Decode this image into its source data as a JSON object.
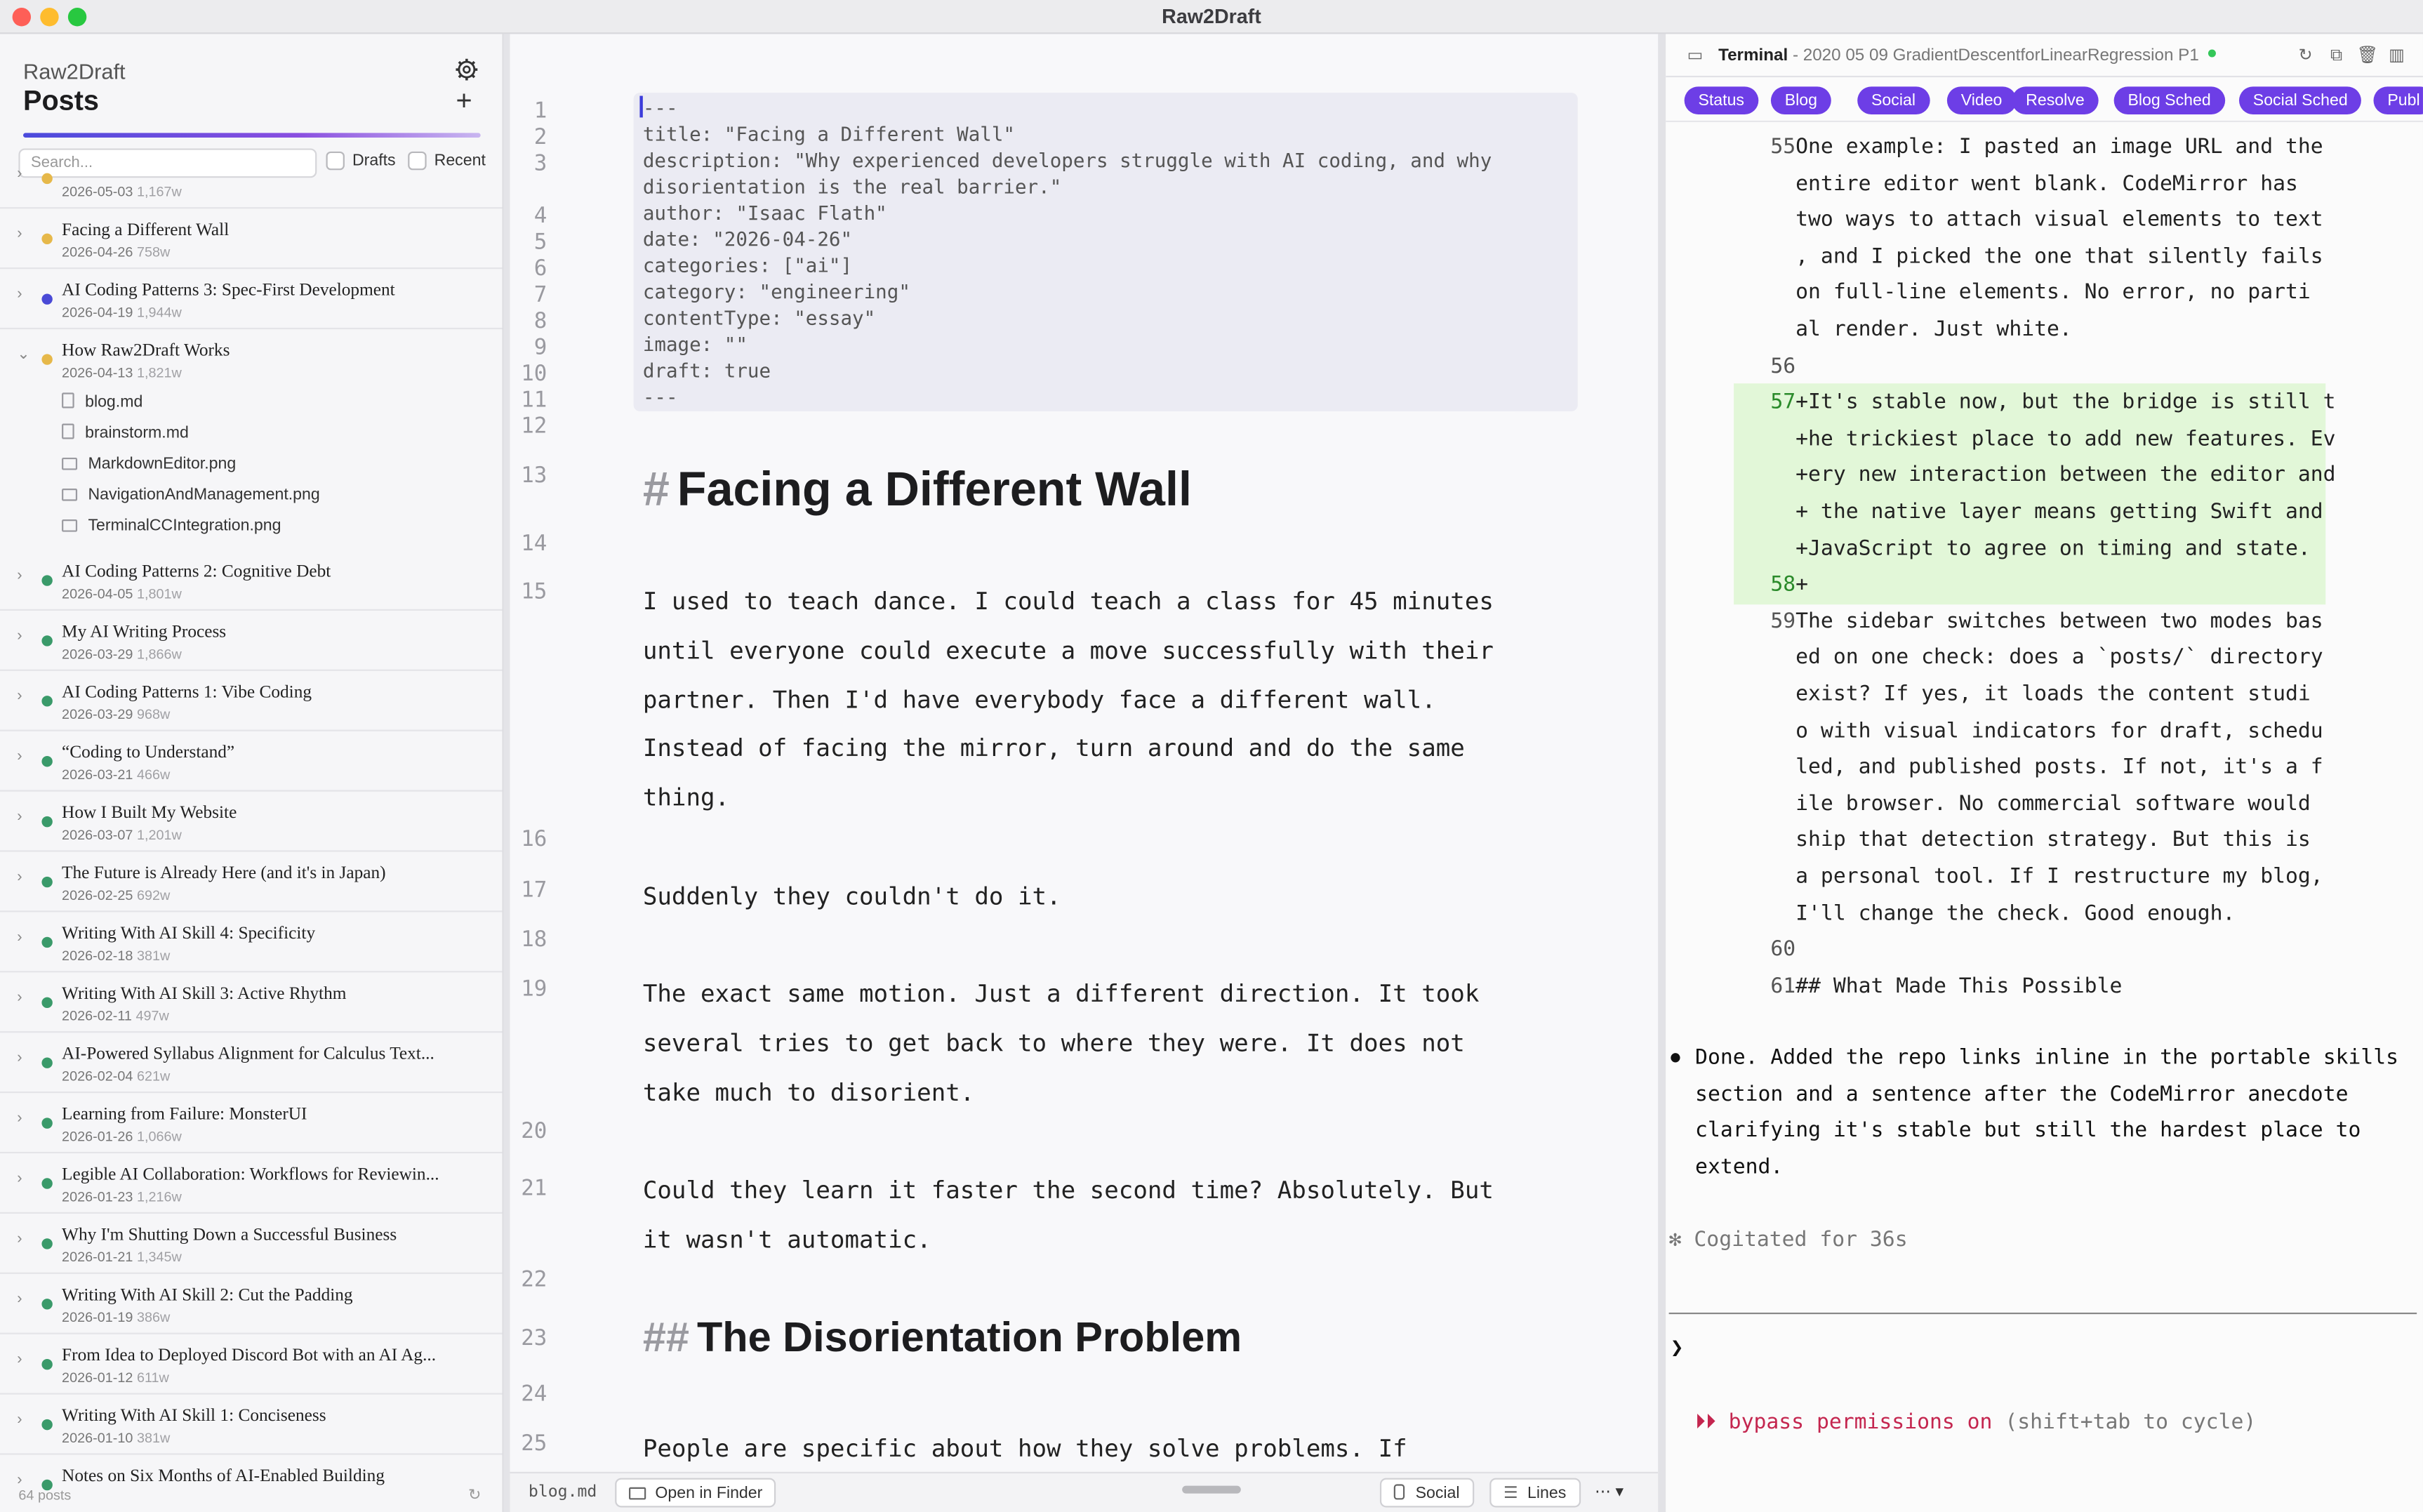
{
  "window": {
    "title": "Raw2Draft"
  },
  "sidebar": {
    "brand": "Raw2Draft",
    "title": "Posts",
    "search_placeholder": "Search...",
    "filter_drafts": "Drafts",
    "filter_recent": "Recent",
    "footer_count": "64 posts",
    "posts": [
      {
        "title": "",
        "date": "2026-05-03",
        "words": "1,167w",
        "status": "draft",
        "expanded": false
      },
      {
        "title": "Facing a Different Wall",
        "date": "2026-04-26",
        "words": "758w",
        "status": "draft",
        "expanded": false
      },
      {
        "title": "AI Coding Patterns 3: Spec-First Development",
        "date": "2026-04-19",
        "words": "1,944w",
        "status": "scheduled",
        "expanded": false
      },
      {
        "title": "How Raw2Draft Works",
        "date": "2026-04-13",
        "words": "1,821w",
        "status": "draft",
        "expanded": true
      },
      {
        "title": "AI Coding Patterns 2: Cognitive Debt",
        "date": "2026-04-05",
        "words": "1,801w",
        "status": "published",
        "expanded": false
      },
      {
        "title": "My AI Writing Process",
        "date": "2026-03-29",
        "words": "1,866w",
        "status": "published",
        "expanded": false
      },
      {
        "title": "AI Coding Patterns 1: Vibe Coding",
        "date": "2026-03-29",
        "words": "968w",
        "status": "published",
        "expanded": false
      },
      {
        "title": "“Coding to Understand”",
        "date": "2026-03-21",
        "words": "466w",
        "status": "published",
        "expanded": false
      },
      {
        "title": "How I Built My Website",
        "date": "2026-03-07",
        "words": "1,201w",
        "status": "published",
        "expanded": false
      },
      {
        "title": "The Future is Already Here (and it's in Japan)",
        "date": "2026-02-25",
        "words": "692w",
        "status": "published",
        "expanded": false
      },
      {
        "title": "Writing With AI Skill 4: Specificity",
        "date": "2026-02-18",
        "words": "381w",
        "status": "published",
        "expanded": false
      },
      {
        "title": "Writing With AI Skill 3: Active Rhythm",
        "date": "2026-02-11",
        "words": "497w",
        "status": "published",
        "expanded": false
      },
      {
        "title": "AI-Powered Syllabus Alignment for Calculus Text...",
        "date": "2026-02-04",
        "words": "621w",
        "status": "published",
        "expanded": false
      },
      {
        "title": "Learning from Failure: MonsterUI",
        "date": "2026-01-26",
        "words": "1,066w",
        "status": "published",
        "expanded": false
      },
      {
        "title": "Legible AI Collaboration: Workflows for Reviewin...",
        "date": "2026-01-23",
        "words": "1,216w",
        "status": "published",
        "expanded": false
      },
      {
        "title": "Why I'm Shutting Down a Successful Business",
        "date": "2026-01-21",
        "words": "1,345w",
        "status": "published",
        "expanded": false
      },
      {
        "title": "Writing With AI Skill 2: Cut the Padding",
        "date": "2026-01-19",
        "words": "386w",
        "status": "published",
        "expanded": false
      },
      {
        "title": "From Idea to Deployed Discord Bot with an AI Ag...",
        "date": "2026-01-12",
        "words": "611w",
        "status": "published",
        "expanded": false
      },
      {
        "title": "Writing With AI Skill 1: Conciseness",
        "date": "2026-01-10",
        "words": "381w",
        "status": "published",
        "expanded": false
      },
      {
        "title": "Notes on Six Months of AI-Enabled Building",
        "date": "",
        "words": "",
        "status": "published",
        "expanded": false
      }
    ],
    "files": [
      "blog.md",
      "brainstorm.md",
      "MarkdownEditor.png",
      "NavigationAndManagement.png",
      "TerminalCCIntegration.png"
    ],
    "status_colors": {
      "draft": "#e6b84a",
      "scheduled": "#4a4ad6",
      "published": "#3a9a6a"
    }
  },
  "editor": {
    "frontmatter": [
      "---",
      "title: \"Facing a Different Wall\"",
      "description: \"Why experienced developers struggle with AI coding, and why",
      "disorientation is the real barrier.\"",
      "author: \"Isaac Flath\"",
      "date: \"2026-04-26\"",
      "categories: [\"ai\"]",
      "category: \"engineering\"",
      "contentType: \"essay\"",
      "image: \"\"",
      "draft: true",
      "---"
    ],
    "line_numbers": [
      "1",
      "2",
      "3",
      "4",
      "5",
      "6",
      "7",
      "8",
      "9",
      "10",
      "11",
      "12",
      "13",
      "14",
      "15",
      "16",
      "17",
      "18",
      "19",
      "20",
      "21",
      "22",
      "23",
      "24",
      "25"
    ],
    "h1_hash": "#",
    "h1": "Facing a Different Wall",
    "para1": [
      "I used to teach dance. I could teach a class for 45 minutes",
      "until everyone could execute a move successfully with their",
      "partner. Then I'd have everybody face a different wall.",
      "Instead of facing the mirror, turn around and do the same",
      "thing."
    ],
    "para2": "Suddenly they couldn't do it.",
    "para3": [
      "The exact same motion. Just a different direction. It took",
      "several tries to get back to where they were. It does not",
      "take much to disorient."
    ],
    "para4": [
      "Could they learn it faster the second time? Absolutely. But",
      "it wasn't automatic."
    ],
    "h2_hash": "##",
    "h2": "The Disorientation Problem",
    "para5": "People are specific about how they solve problems. If",
    "footer": {
      "filename": "blog.md",
      "open_in_finder": "Open in Finder",
      "social": "Social",
      "lines": "Lines",
      "more": "⋯ ▾"
    }
  },
  "terminal": {
    "title": "Terminal",
    "subtitle": "- 2020 05 09 GradientDescentforLinearRegression P1",
    "pills": [
      "Status",
      "Blog",
      "Social",
      "Video",
      "Resolve",
      "Blog Sched",
      "Social Sched",
      "Publ"
    ],
    "diff": [
      {
        "num": "55",
        "text": "One example: I pasted an image URL and the"
      },
      {
        "num": "",
        "text": " entire editor went blank. CodeMirror has"
      },
      {
        "num": "",
        "text": "two ways to attach visual elements to text"
      },
      {
        "num": "",
        "text": ", and I picked the one that silently fails"
      },
      {
        "num": "",
        "text": " on full-line elements. No error, no parti"
      },
      {
        "num": "",
        "text": "al render. Just white."
      },
      {
        "num": "56",
        "text": ""
      },
      {
        "num": "57",
        "text": "+It's stable now, but the bridge is still t",
        "add": true
      },
      {
        "num": "",
        "text": "+he trickiest place to add new features. Ev",
        "add": true
      },
      {
        "num": "",
        "text": "+ery new interaction between the editor and",
        "add": true
      },
      {
        "num": "",
        "text": "+ the native layer means getting Swift and",
        "add": true
      },
      {
        "num": "",
        "text": "+JavaScript to agree on timing and state.",
        "add": true
      },
      {
        "num": "58",
        "text": "+",
        "add": true
      },
      {
        "num": "59",
        "text": "The sidebar switches between two modes bas"
      },
      {
        "num": "",
        "text": "ed on one check: does a `posts/` directory"
      },
      {
        "num": "",
        "text": " exist? If yes, it loads the content studi"
      },
      {
        "num": "",
        "text": "o with visual indicators for draft, schedu"
      },
      {
        "num": "",
        "text": "led, and published posts. If not, it's a f"
      },
      {
        "num": "",
        "text": "ile browser. No commercial software would"
      },
      {
        "num": "",
        "text": "ship that detection strategy. But this is"
      },
      {
        "num": "",
        "text": "a personal tool. If I restructure my blog,"
      },
      {
        "num": "",
        "text": " I'll change the check. Good enough."
      },
      {
        "num": "60",
        "text": ""
      },
      {
        "num": "61",
        "text": "## What Made This Possible"
      }
    ],
    "bullet": "●",
    "done": [
      "Done. Added the repo links inline in the portable skills",
      "section and a sentence after the CodeMirror anecdote",
      "clarifying it's stable but still the hardest place to",
      "extend."
    ],
    "cogitated": "✻ Cogitated for 36s",
    "prompt": "❯",
    "bypass_arrows": "⏵⏵",
    "bypass_red": "bypass permissions on",
    "bypass_hint": "(shift+tab to cycle)"
  }
}
